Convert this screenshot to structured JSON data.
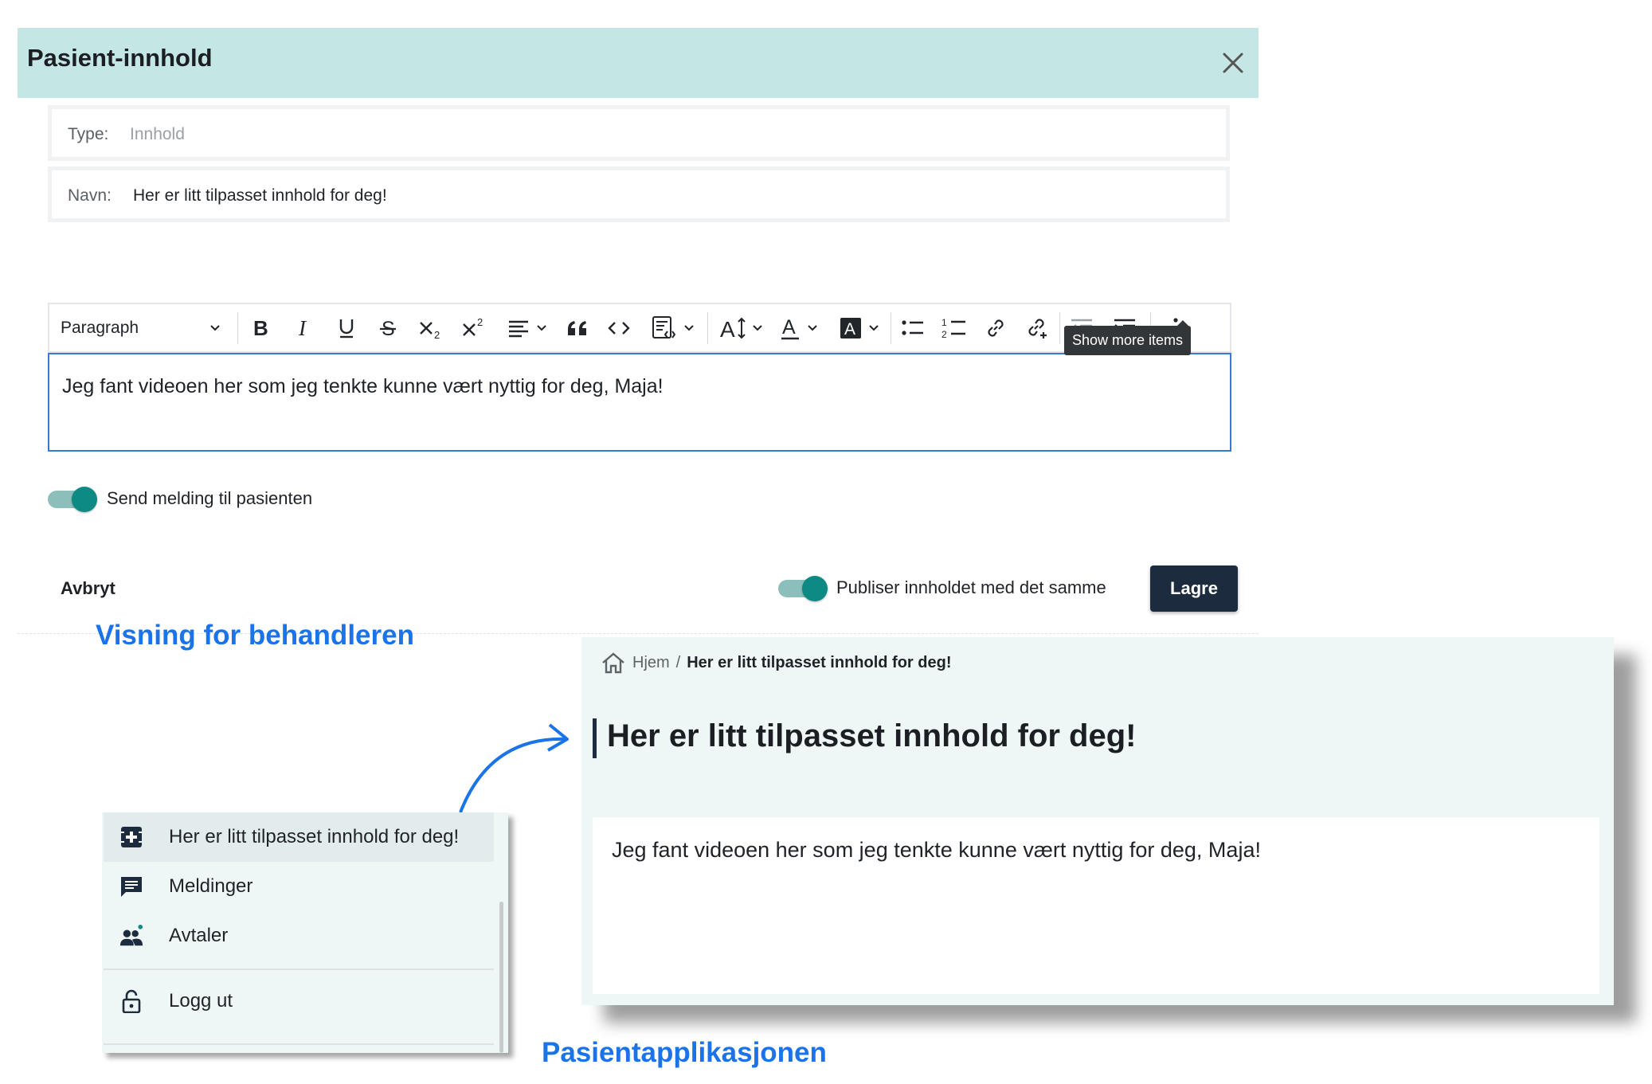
{
  "modal": {
    "title": "Pasient-innhold",
    "type_label": "Type:",
    "type_placeholder": "Innhold",
    "name_label": "Navn:",
    "name_value": "Her er litt tilpasset innhold for deg!",
    "editor": {
      "paragraph_select": "Paragraph",
      "body_text": "Jeg fant videoen her som jeg tenkte kunne vært nyttig for deg, Maja!",
      "tooltip": "Show more items",
      "toolbar_icons": [
        "bold-icon",
        "italic-icon",
        "underline-icon",
        "strikethrough-icon",
        "subscript-icon",
        "superscript-icon",
        "align-icon",
        "blockquote-icon",
        "code-icon",
        "insert-template-icon",
        "font-size-icon",
        "font-color-icon",
        "highlight-icon",
        "bulleted-list-icon",
        "numbered-list-icon",
        "link-icon",
        "link-add-icon",
        "outdent-icon",
        "indent-icon",
        "more-icon"
      ]
    },
    "send_message_toggle": {
      "label": "Send melding til pasienten",
      "on": true
    },
    "publish_toggle": {
      "label": "Publiser innholdet med det samme",
      "on": true
    },
    "cancel_label": "Avbryt",
    "save_label": "Lagre"
  },
  "captions": {
    "clinician_view": "Visning for behandleren",
    "patient_app": "Pasientapplikasjonen"
  },
  "patient_preview": {
    "breadcrumb_home": "Hjem",
    "breadcrumb_sep": "/",
    "breadcrumb_current": "Her er litt tilpasset innhold for deg!",
    "title": "Her er litt tilpasset innhold for deg!",
    "body": "Jeg fant videoen her som jeg tenkte kunne vært nyttig for deg, Maja!"
  },
  "patient_menu": {
    "items": [
      {
        "label": "Her er litt tilpasset innhold for deg!",
        "icon": "medical-content-icon",
        "active": true
      },
      {
        "label": "Meldinger",
        "icon": "message-icon",
        "active": false
      },
      {
        "label": "Avtaler",
        "icon": "people-icon",
        "active": false
      },
      {
        "label": "Logg ut",
        "icon": "lock-icon",
        "active": false
      }
    ]
  },
  "colors": {
    "header_bg": "#c4e6e5",
    "accent_teal": "#0e8a84",
    "primary_button": "#1d2b3f",
    "caption_blue": "#1a73e8",
    "editor_focus": "#3a78d8"
  }
}
